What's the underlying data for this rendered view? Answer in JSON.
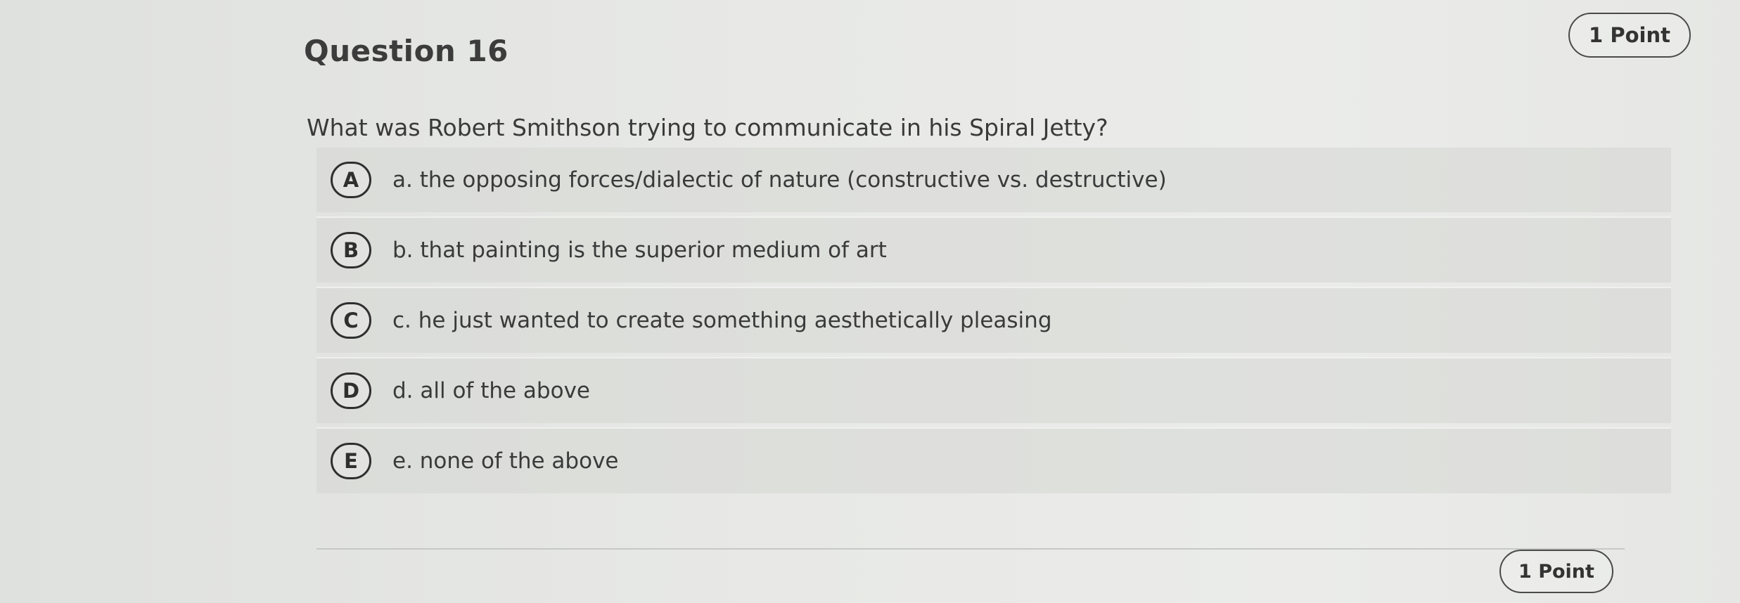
{
  "question": {
    "title": "Question 16",
    "points": "1 Point",
    "prompt": "What was Robert Smithson trying to communicate in his Spiral Jetty?",
    "options": [
      {
        "letter": "A",
        "text": "a. the opposing forces/dialectic of nature (constructive vs. destructive)"
      },
      {
        "letter": "B",
        "text": "b. that painting is the superior medium of art"
      },
      {
        "letter": "C",
        "text": "c. he just wanted to create something aesthetically pleasing"
      },
      {
        "letter": "D",
        "text": "d. all of the above"
      },
      {
        "letter": "E",
        "text": "e. none of the above"
      }
    ]
  },
  "next_question": {
    "points": "1 Point"
  },
  "colors": {
    "background": "#e8e9e6",
    "option_background": "#d0d2cf",
    "text": "#3a3a3a",
    "border": "#2f2f2f"
  }
}
